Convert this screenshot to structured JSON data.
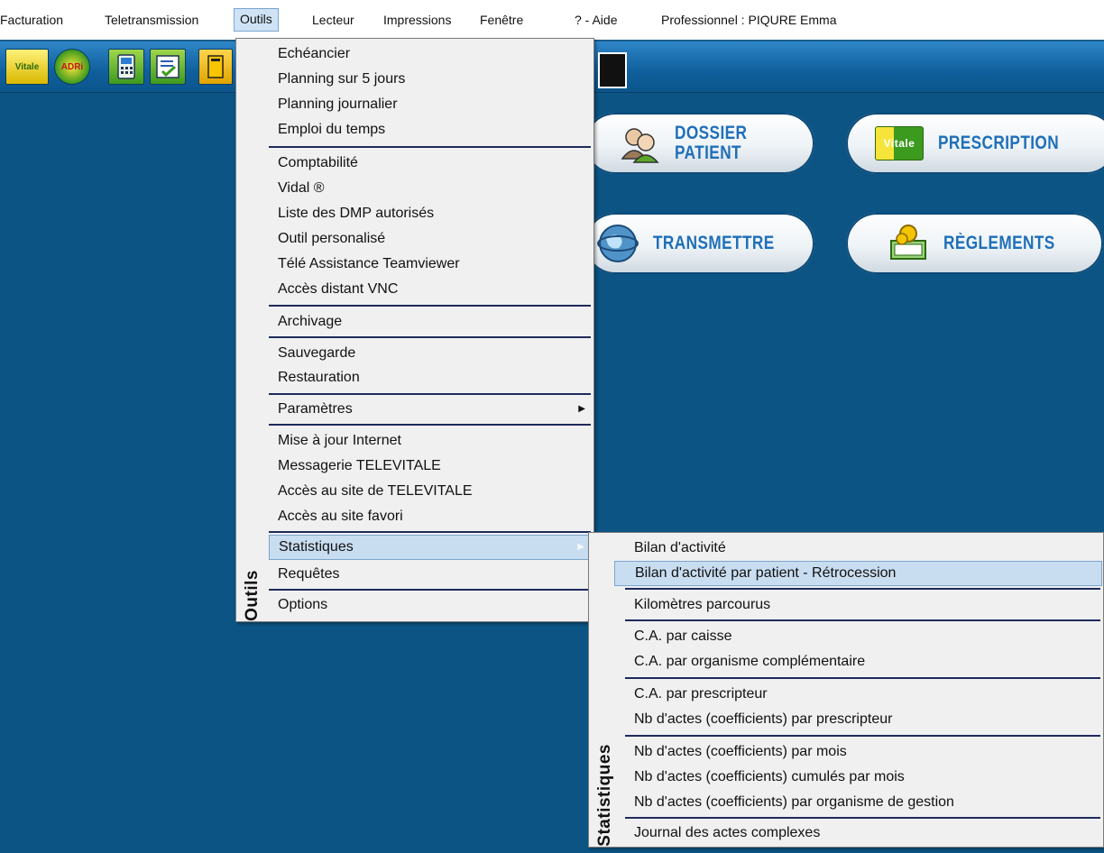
{
  "menubar": {
    "items": [
      "Facturation",
      "Teletransmission",
      "Outils",
      "Lecteur",
      "Impressions",
      "Fenêtre",
      "? - Aide"
    ],
    "professional": "Professionnel : PIQURE Emma"
  },
  "toolbar": {
    "icons": [
      "vitale-icon",
      "adri-icon",
      "card-reader-icon",
      "checklist-icon",
      "document-icon",
      "monitor-icon"
    ],
    "vitale_label": "Vitale",
    "adri_label": "ADRi"
  },
  "dashboard": {
    "dossier_patient": "DOSSIER\nPATIENT",
    "prescription": "PRESCRIPTION",
    "transmettre": "TRANSMETTRE",
    "reglements": "RÈGLEMENTS",
    "vitale_badge": "Vitale"
  },
  "outils_menu": {
    "title": "Outils",
    "items": [
      "Echéancier",
      "Planning sur 5 jours",
      "Planning journalier",
      "Emploi du temps",
      "Comptabilité",
      "Vidal ®",
      "Liste des DMP autorisés",
      "Outil personalisé",
      "Télé Assistance Teamviewer",
      "Accès distant VNC",
      "Archivage",
      "Sauvegarde",
      "Restauration",
      "Paramètres",
      "Mise à jour Internet",
      "Messagerie TELEVITALE",
      "Accès au site de TELEVITALE",
      "Accès au site favori",
      "Statistiques",
      "Requêtes",
      "Options"
    ],
    "highlighted": "Statistiques"
  },
  "stats_menu": {
    "title": "Statistiques",
    "items": [
      "Bilan d'activité",
      "Bilan d'activité par patient - Rétrocession",
      "Kilomètres parcourus",
      "C.A. par caisse",
      "C.A. par organisme complémentaire",
      "C.A. par prescripteur",
      "Nb d'actes (coefficients) par prescripteur",
      "Nb d'actes (coefficients) par mois",
      "Nb d'actes (coefficients) cumulés par mois",
      "Nb d'actes (coefficients) par organisme de gestion",
      "Journal des actes complexes"
    ],
    "highlighted": "Bilan d'activité par patient - Rétrocession"
  },
  "colors": {
    "background": "#0c5484",
    "pill_text": "#1f6fb8",
    "highlight": "#c9ddf1",
    "separator": "#1e2a5c"
  }
}
